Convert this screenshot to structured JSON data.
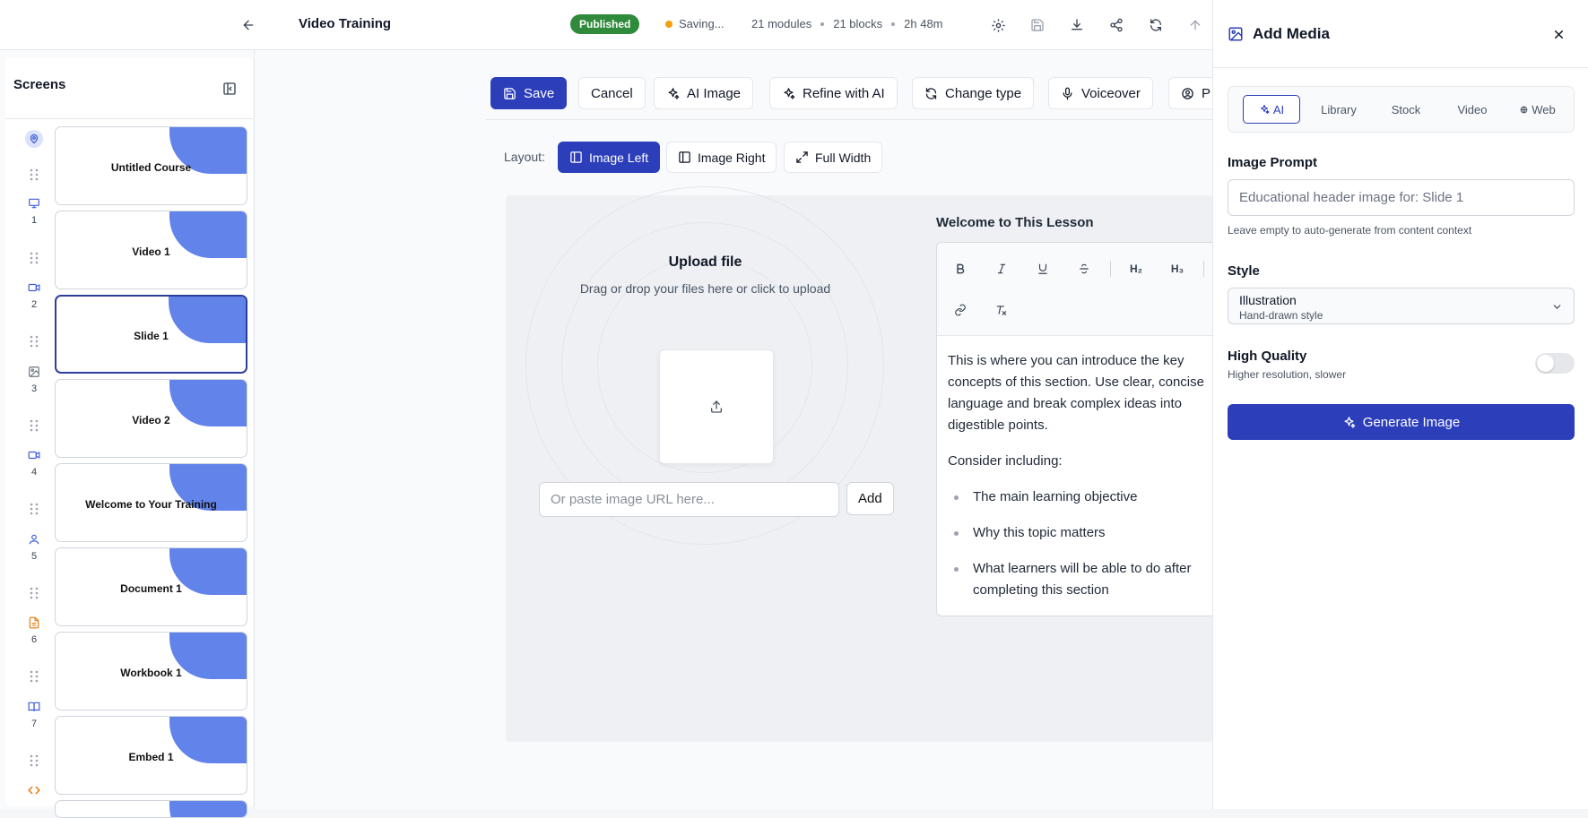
{
  "header": {
    "title": "Video Training",
    "status": "Published",
    "saving": "Saving...",
    "modules": "21 modules",
    "blocks": "21 blocks",
    "duration": "2h 48m",
    "status_color": "#2f8a3b",
    "saving_color": "#f59e0b"
  },
  "sidebar": {
    "title": "Screens",
    "screens": [
      {
        "title": "Untitled Course",
        "num": "",
        "icon": "location-pin-icon"
      },
      {
        "title": "Video 1",
        "num": "1",
        "icon": "monitor-icon"
      },
      {
        "title": "Slide 1",
        "num": "2",
        "icon": "video-camera-icon"
      },
      {
        "title": "Video 2",
        "num": "3",
        "icon": "image-icon"
      },
      {
        "title": "Welcome to Your Training",
        "num": "4",
        "icon": "video-camera-icon"
      },
      {
        "title": "Document 1",
        "num": "5",
        "icon": "user-icon"
      },
      {
        "title": "Workbook 1",
        "num": "6",
        "icon": "document-icon"
      },
      {
        "title": "Embed 1",
        "num": "7",
        "icon": "book-icon"
      }
    ],
    "last_icon": "code-icon",
    "accent": "#6283ea"
  },
  "toolbar": {
    "save": "Save",
    "cancel": "Cancel",
    "ai_image": "AI Image",
    "refine": "Refine with AI",
    "change_type": "Change type",
    "voiceover": "Voiceover",
    "partial": "P"
  },
  "layout": {
    "label": "Layout:",
    "image_left": "Image Left",
    "image_right": "Image Right",
    "full_width": "Full Width"
  },
  "upload": {
    "title": "Upload file",
    "subtitle": "Drag or drop your files here or click to upload",
    "url_placeholder": "Or paste image URL here...",
    "add": "Add"
  },
  "editor": {
    "title": "Welcome to This Lesson",
    "h2": "H₂",
    "h3": "H₃",
    "para1": "This is where you can introduce the key concepts of this section. Use clear, concise language and break complex ideas into digestible points.",
    "para2": "Consider including:",
    "bullets": [
      "The main learning objective",
      "Why this topic matters",
      "What learners will be able to do after completing this section"
    ]
  },
  "panel": {
    "title": "Add Media",
    "tabs": [
      "AI",
      "Library",
      "Stock",
      "Video",
      "Web"
    ],
    "prompt_label": "Image Prompt",
    "prompt_placeholder": "Educational header image for: Slide 1",
    "prompt_hint": "Leave empty to auto-generate from content context",
    "style_label": "Style",
    "style_value": "Illustration",
    "style_sub": "Hand-drawn style",
    "quality_label": "High Quality",
    "quality_sub": "Higher resolution, slower",
    "generate": "Generate Image",
    "accent": "#2c3eba"
  }
}
